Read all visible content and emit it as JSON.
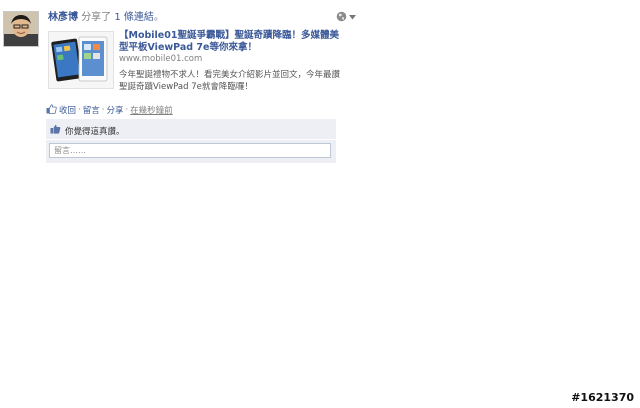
{
  "story": {
    "author": "林彥博",
    "shared_text": "分享了",
    "link_count": "1 條連結",
    "period": "。"
  },
  "privacy": {
    "icon": "globe-icon",
    "caret": "chevron-down-icon"
  },
  "attachment": {
    "title": "【Mobile01聖誕爭霸戰】聖誕奇蹟降臨！多媒體美型平板ViewPad 7e等你來拿！",
    "url": "www.mobile01.com",
    "description": "今年聖誕禮物不求人！看完美女介紹影片並回文，今年最讚聖誕奇蹟ViewPad 7e就會降臨囉！"
  },
  "actions": {
    "unlike": "收回",
    "comment": "留言",
    "share": "分享",
    "timestamp": "在幾秒鐘前",
    "sep": "·"
  },
  "feedback": {
    "like_text": "你覺得這真讚。",
    "comment_placeholder": "留言……"
  },
  "watermark": "#1621370",
  "colors": {
    "link": "#3b5998",
    "feedback_bg": "#edeff4",
    "input_border": "#bdc7d8"
  }
}
